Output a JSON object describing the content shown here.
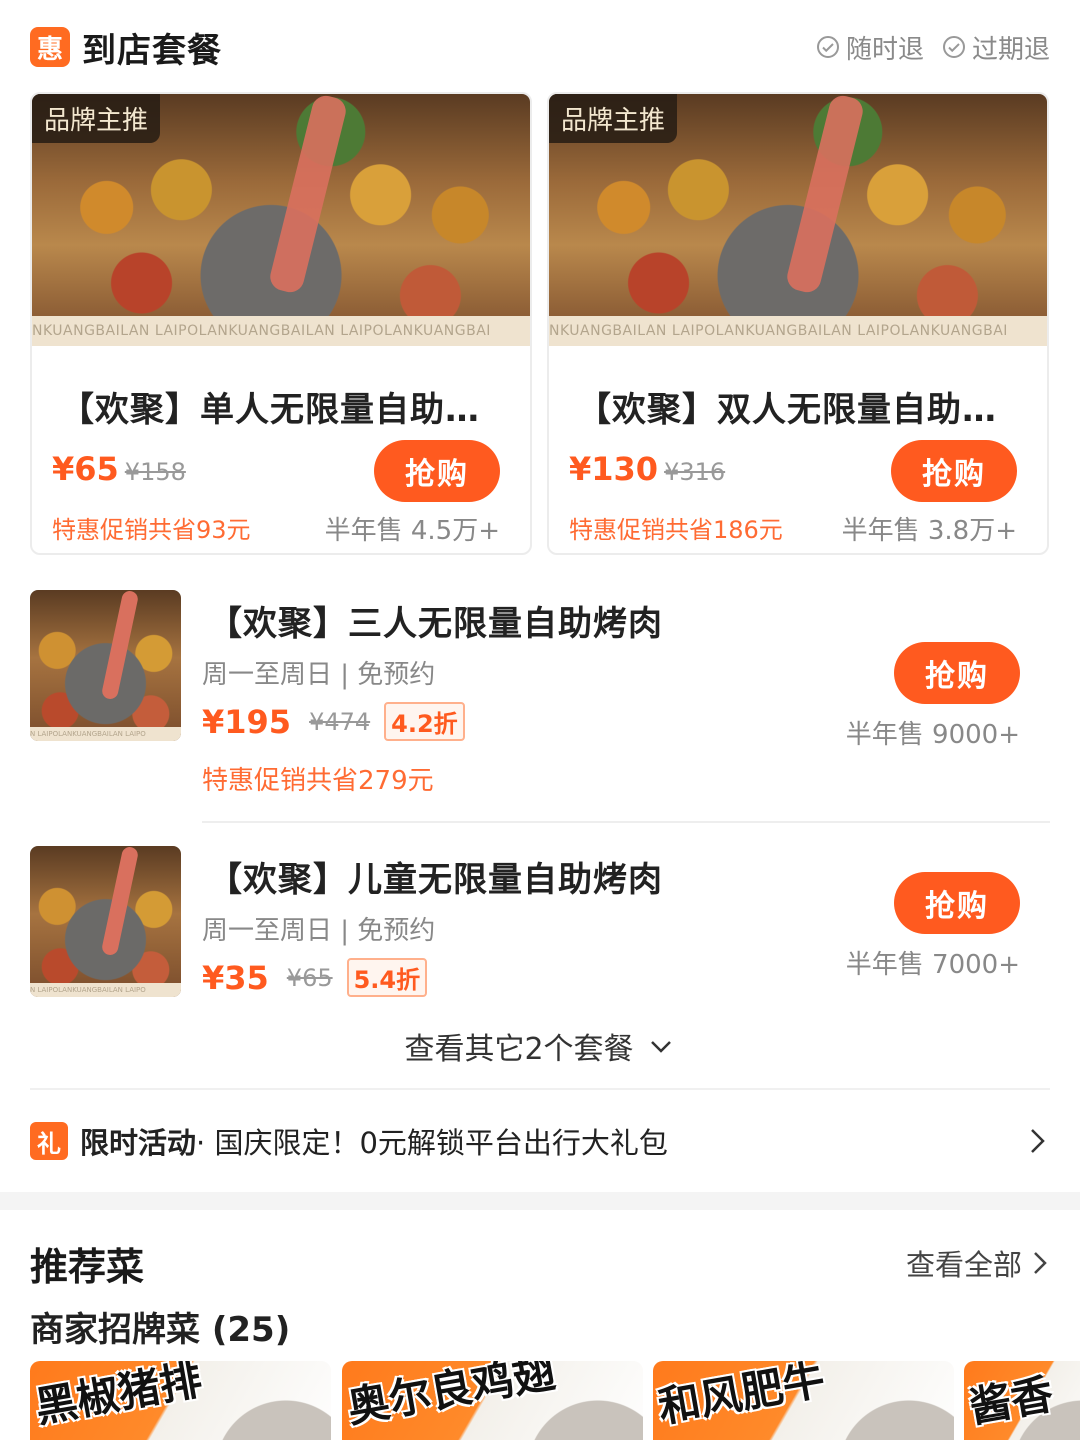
{
  "header": {
    "badge": "惠",
    "title": "到店套餐",
    "tags": [
      "随时退",
      "过期退"
    ]
  },
  "cards": [
    {
      "brand_tag": "品牌主推",
      "photo_strip": "NKUANGBAILAN  LAIPOLANKUANGBAILAN  LAIPOLANKUANGBAI",
      "title": "【欢聚】单人无限量自助…",
      "price": "¥65",
      "original_price": "¥158",
      "buy": "抢购",
      "savings": "特惠促销共省93元",
      "sold": "半年售 4.5万+"
    },
    {
      "brand_tag": "品牌主推",
      "photo_strip": "NKUANGBAILAN  LAIPOLANKUANGBAILAN  LAIPOLANKUANGBAI",
      "title": "【欢聚】双人无限量自助…",
      "price": "¥130",
      "original_price": "¥316",
      "buy": "抢购",
      "savings": "特惠促销共省186元",
      "sold": "半年售 3.8万+"
    }
  ],
  "items": [
    {
      "title": "【欢聚】三人无限量自助烤肉",
      "subtitle": "周一至周日 | 免预约",
      "price": "¥195",
      "original_price": "¥474",
      "discount": "4.2折",
      "savings": "特惠促销共省279元",
      "buy": "抢购",
      "sold": "半年售 9000+",
      "thumb_strip": "N LAIPOLANKUANGBAILAN LAIPO"
    },
    {
      "title": "【欢聚】儿童无限量自助烤肉",
      "subtitle": "周一至周日 | 免预约",
      "price": "¥35",
      "original_price": "¥65",
      "discount": "5.4折",
      "buy": "抢购",
      "sold": "半年售 7000+",
      "thumb_strip": "N LAIPOLANKUANGBAILAN LAIPO"
    }
  ],
  "more_packages": "查看其它2个套餐",
  "promo": {
    "icon_text": "礼",
    "label": "限时活动",
    "text": "· 国庆限定！0元解锁平台出行大礼包"
  },
  "recommended": {
    "title": "推荐菜",
    "view_all": "查看全部",
    "signature": "商家招牌菜 (25)",
    "dishes": [
      "黑椒猪排",
      "奥尔良鸡翅",
      "和风肥牛",
      "酱香"
    ]
  },
  "colors": {
    "accent": "#ff5a1f",
    "badge": "#ff6b21",
    "muted": "#888888"
  }
}
